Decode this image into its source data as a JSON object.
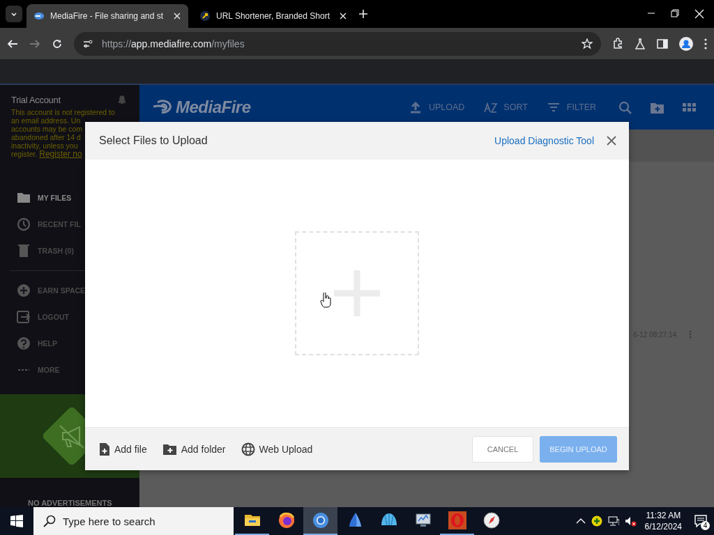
{
  "browser": {
    "tabs": [
      {
        "title": "MediaFire - File sharing and st",
        "kind": "mediafire",
        "selected": true
      },
      {
        "title": "URL Shortener, Branded Short",
        "kind": "shortener",
        "selected": false
      }
    ],
    "address": {
      "scheme": "https://",
      "host": "app.mediafire.com",
      "path": "/myfiles"
    }
  },
  "sidebar": {
    "account_title": "Trial Account",
    "warning_lines": [
      "This account is not registered to",
      "an email address. Un",
      "accounts may be com",
      "abandoned after 14 d",
      "inactivity, unless you"
    ],
    "warning_end": "register.",
    "register_link": "Register no",
    "items": [
      {
        "label": "MY FILES",
        "kind": "folder",
        "selected": true
      },
      {
        "label": "RECENT FIL",
        "kind": "clock",
        "selected": false
      },
      {
        "label": "TRASH (0)",
        "kind": "trash",
        "selected": false
      },
      {
        "label": "EARN SPACE",
        "kind": "plus",
        "selected": false
      },
      {
        "label": "LOGOUT",
        "kind": "logout",
        "selected": false
      },
      {
        "label": "HELP",
        "kind": "help",
        "selected": false
      },
      {
        "label": "MORE",
        "kind": "more",
        "selected": false
      }
    ],
    "promo_caption": "NO ADVERTISEMENTS"
  },
  "header": {
    "logo": "MediaFire",
    "actions": [
      {
        "label": "UPLOAD",
        "kind": "upload"
      },
      {
        "label": "SORT",
        "kind": "sort"
      },
      {
        "label": "FILTER",
        "kind": "filter"
      }
    ]
  },
  "files": {
    "rows": [
      {
        "modified": "6-12 08:27:14"
      }
    ]
  },
  "modal": {
    "title": "Select Files to Upload",
    "diagnostic_link": "Upload Diagnostic Tool",
    "sources": [
      {
        "label": "Add file",
        "kind": "file"
      },
      {
        "label": "Add folder",
        "kind": "folder"
      },
      {
        "label": "Web Upload",
        "kind": "web"
      }
    ],
    "buttons": [
      {
        "label": "CANCEL",
        "kind": "secondary",
        "disabled": false
      },
      {
        "label": "BEGIN UPLOAD",
        "kind": "primary",
        "disabled": true
      }
    ]
  },
  "taskbar": {
    "search_placeholder": "Type here to search",
    "apps": [
      {
        "kind": "explorer",
        "open": true,
        "selected": false
      },
      {
        "kind": "firefox",
        "open": false,
        "selected": false
      },
      {
        "kind": "chrome",
        "open": true,
        "selected": true
      },
      {
        "kind": "sail",
        "open": false,
        "selected": false
      },
      {
        "kind": "shell",
        "open": false,
        "selected": false
      },
      {
        "kind": "monitor",
        "open": false,
        "selected": false
      },
      {
        "kind": "opera",
        "open": true,
        "selected": false
      },
      {
        "kind": "compass",
        "open": false,
        "selected": false
      }
    ],
    "time": "11:32 AM",
    "date": "6/12/2024",
    "notification_count": "4"
  }
}
